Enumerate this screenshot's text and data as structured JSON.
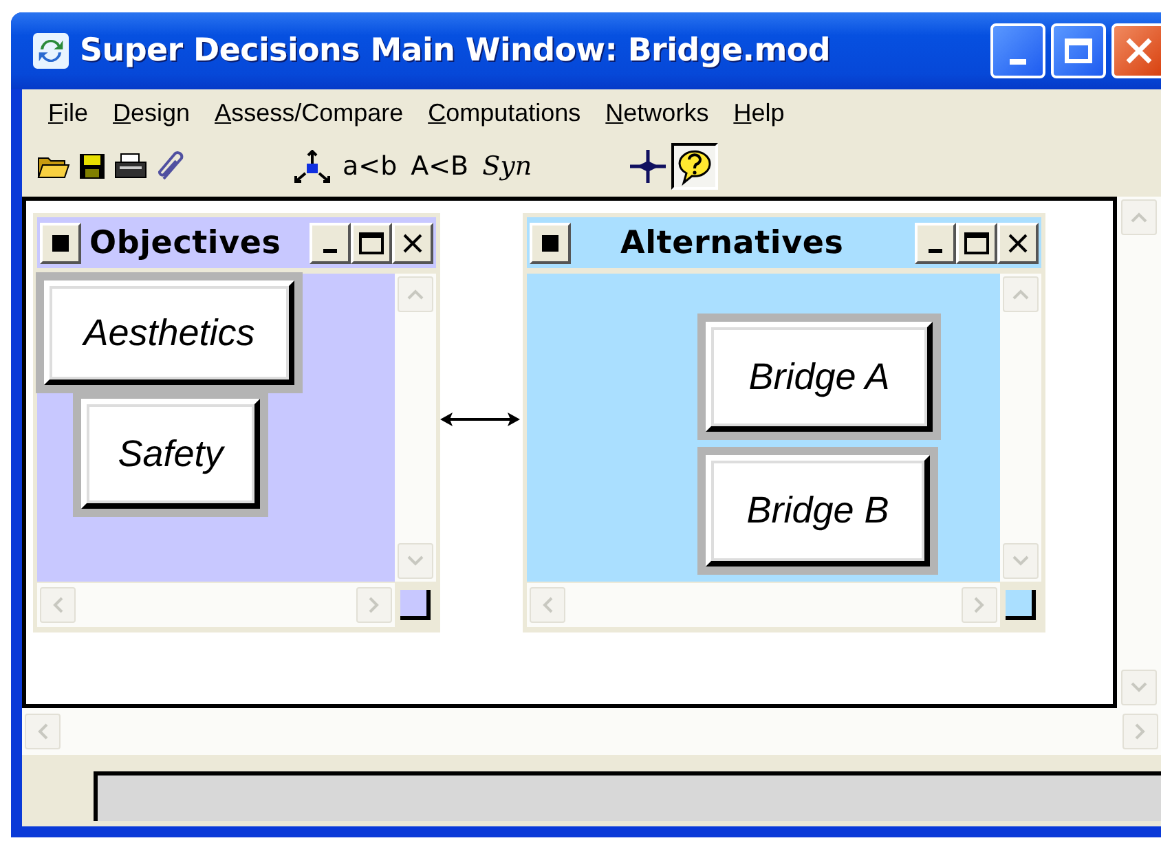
{
  "window": {
    "title": "Super Decisions Main Window: Bridge.mod"
  },
  "menu": [
    {
      "label": "File"
    },
    {
      "label": "Design"
    },
    {
      "label": "Assess/Compare"
    },
    {
      "label": "Computations"
    },
    {
      "label": "Networks"
    },
    {
      "label": "Help"
    }
  ],
  "toolbar": {
    "text_tools": [
      {
        "label": "a<b",
        "italic": false
      },
      {
        "label": "A<B",
        "italic": false
      },
      {
        "label": "Syn",
        "italic": true
      }
    ],
    "help_pressed": true
  },
  "clusters": [
    {
      "title": "Objectives",
      "color": "#c8c8ff",
      "nodes": [
        {
          "label": "Aesthetics"
        },
        {
          "label": "Safety"
        }
      ]
    },
    {
      "title": "Alternatives",
      "color": "#aadfff",
      "nodes": [
        {
          "label": "Bridge A"
        },
        {
          "label": "Bridge B"
        }
      ]
    }
  ],
  "links": [
    {
      "bidirectional": true
    }
  ]
}
